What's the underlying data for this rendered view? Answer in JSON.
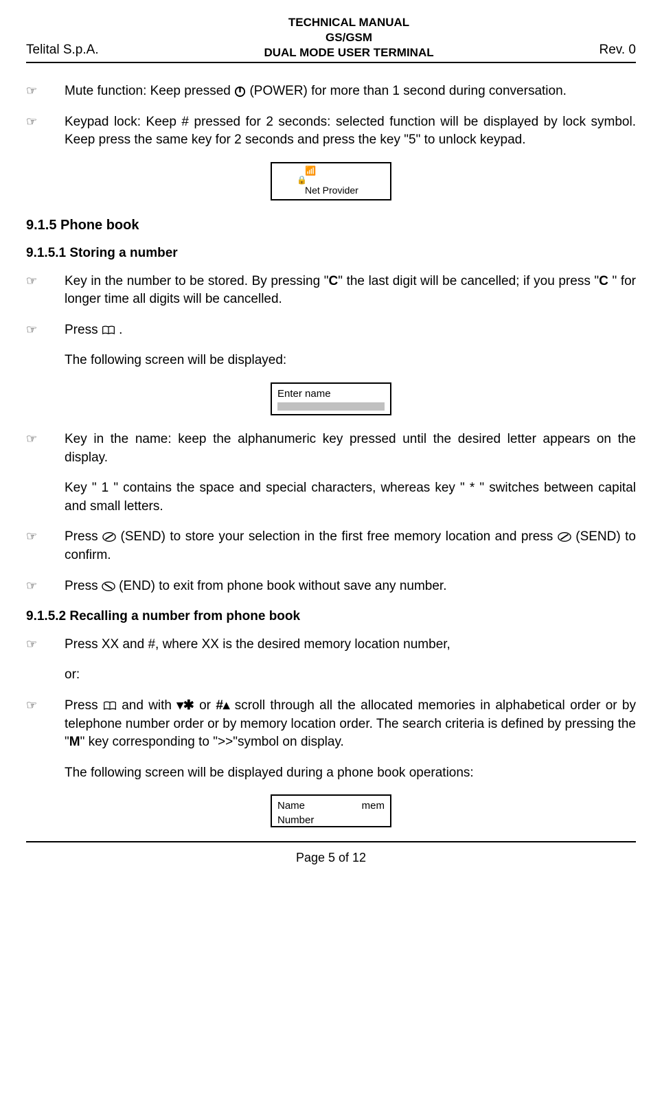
{
  "header": {
    "left": "Telital S.p.A.",
    "center_l1": "TECHNICAL MANUAL",
    "center_l2": "GS/GSM",
    "center_l3": "DUAL MODE USER TERMINAL",
    "right": "Rev. 0"
  },
  "items": {
    "mute": "Mute function: Keep pressed ",
    "mute2": " (POWER) for more than 1 second during conversation.",
    "keypad": "Keypad lock: Keep # pressed for 2 seconds: selected function will be displayed by lock symbol. Keep press the same key for 2 seconds and press the key \"5\"  to unlock keypad.",
    "netprov": "Net Provider",
    "s915": "9.1.5 Phone book",
    "s9151": "9.1.5.1 Storing a number",
    "store1a": "Key in the number to be stored. By pressing \"",
    "store1b": "\" the last digit will be cancelled; if you press \"",
    "store1c": " \" for longer time all digits will be cancelled.",
    "c": "C",
    "press": "Press ",
    "dot": " .",
    "following": "The following screen will be displayed:",
    "entername": "Enter name",
    "keyname": "Key in the name: keep the alphanumeric key pressed until the desired letter appears on the display.",
    "key1": "Key \" 1 \" contains the space and special characters, whereas key \" * \" switches between capital and small letters.",
    "send1": "(SEND) to store your selection in the first free memory location and press ",
    "send2": "(SEND) to confirm.",
    "end": "(END) to exit from phone book without save any number.",
    "s9152": "9.1.5.2 Recalling a number from phone book",
    "recall1": "Press XX and #, where XX is the desired memory location number,",
    "or": "or:",
    "recall2a": "Press ",
    "recall2b": " and with ",
    "recall2c": " or ",
    "recall2d": " scroll through all the allocated memories in alphabetical order or by telephone number order or by memory location order. The search criteria is defined by pressing the \"",
    "recall2e": "\" key corresponding to \">>\"symbol  on display.",
    "m": "M",
    "following2": "The following screen will be displayed during a phone book operations:",
    "name": "Name",
    "mem": "mem",
    "number": "Number",
    "down": "▾✱",
    "up": "#▴"
  },
  "footer": "Page 5 of 12"
}
